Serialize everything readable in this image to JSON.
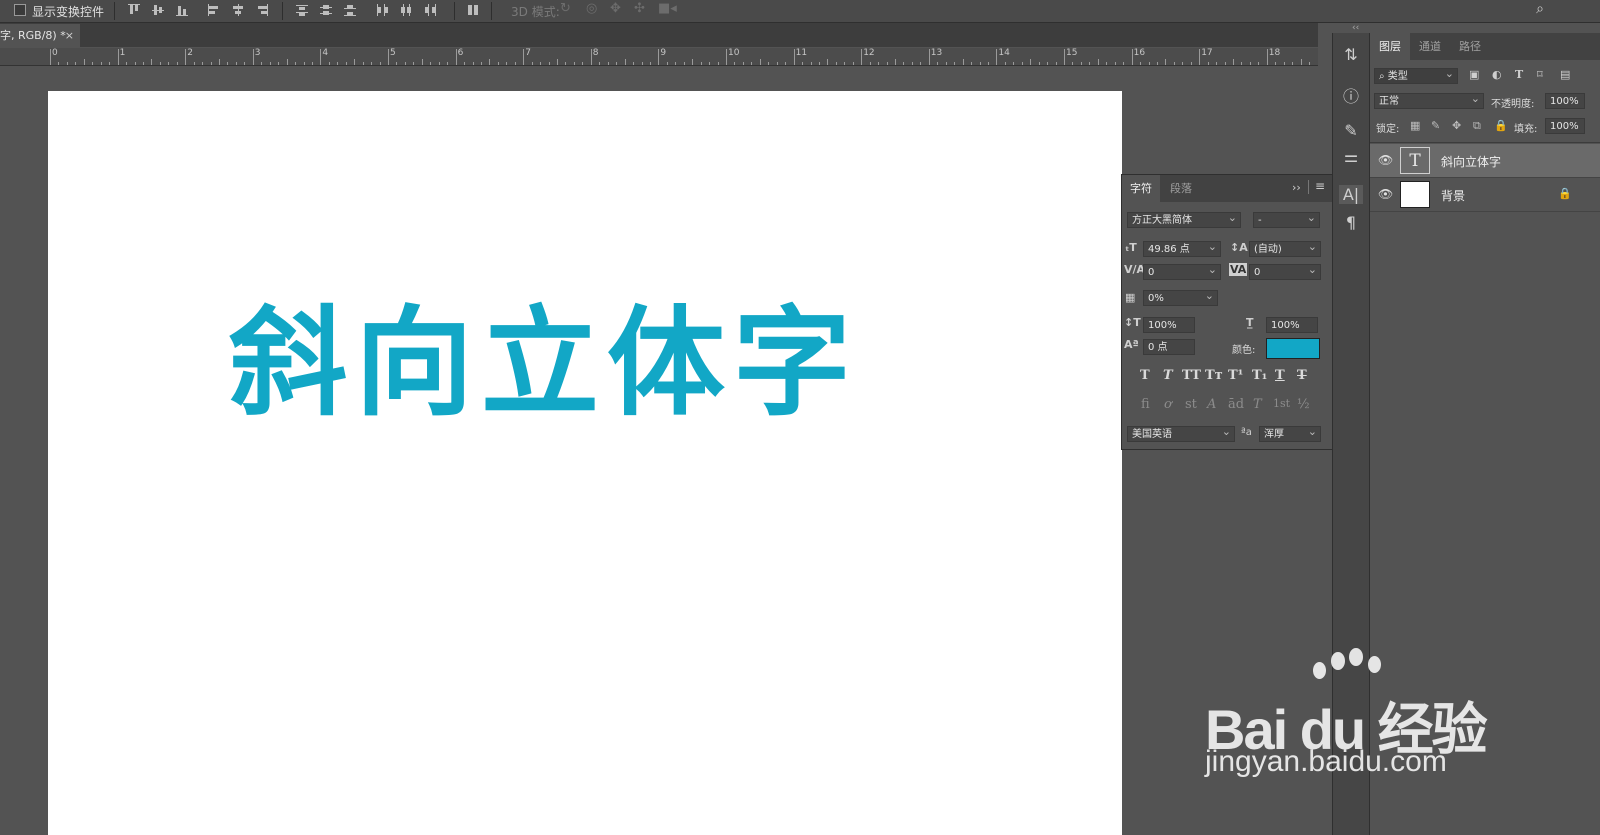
{
  "options_bar": {
    "show_transform_controls": "显示变换控件",
    "mode_3d": "3D 模式:"
  },
  "document_tab": {
    "title": "字, RGB/8) *",
    "close": "×"
  },
  "ruler": {
    "marks": [
      "0",
      "1",
      "2",
      "3",
      "4",
      "5",
      "6",
      "7",
      "8",
      "9",
      "10",
      "11",
      "12",
      "13",
      "14",
      "15",
      "16",
      "17",
      "18"
    ]
  },
  "canvas": {
    "text": "斜向立体字",
    "text_color": "#12a7c6",
    "background": "#ffffff"
  },
  "character_panel": {
    "tabs": [
      "字符",
      "段落"
    ],
    "font_family": "方正大黑简体",
    "font_style": "-",
    "font_size": "49.86 点",
    "leading": "(自动)",
    "kerning": "0",
    "tracking": "0",
    "tsume": "0%",
    "vertical_scale": "100%",
    "horizontal_scale": "100%",
    "baseline_shift": "0 点",
    "color_label": "颜色:",
    "color": "#12a7c6",
    "type_buttons": [
      "T",
      "T",
      "TT",
      "Tт",
      "T¹",
      "T₁",
      "T",
      "T"
    ],
    "opentype_buttons": [
      "fi",
      "ơ",
      "st",
      "A",
      "ād",
      "T",
      "1st",
      "½"
    ],
    "language": "美国英语",
    "aa_icon": "ªa",
    "antialias": "浑厚"
  },
  "layers_panel": {
    "tabs": [
      "图层",
      "通道",
      "路径"
    ],
    "filter_kind": "类型",
    "blend_mode": "正常",
    "opacity_label": "不透明度:",
    "opacity": "100%",
    "lock_label": "锁定:",
    "fill_label": "填充:",
    "fill": "100%",
    "layers": [
      {
        "name": "斜向立体字",
        "kind": "text",
        "visible": true,
        "selected": true,
        "thumb": "T"
      },
      {
        "name": "背景",
        "kind": "background",
        "visible": true,
        "selected": false,
        "thumb": ""
      }
    ]
  },
  "watermark": {
    "logo": "Bai du 经验",
    "url": "jingyan.baidu.com"
  }
}
